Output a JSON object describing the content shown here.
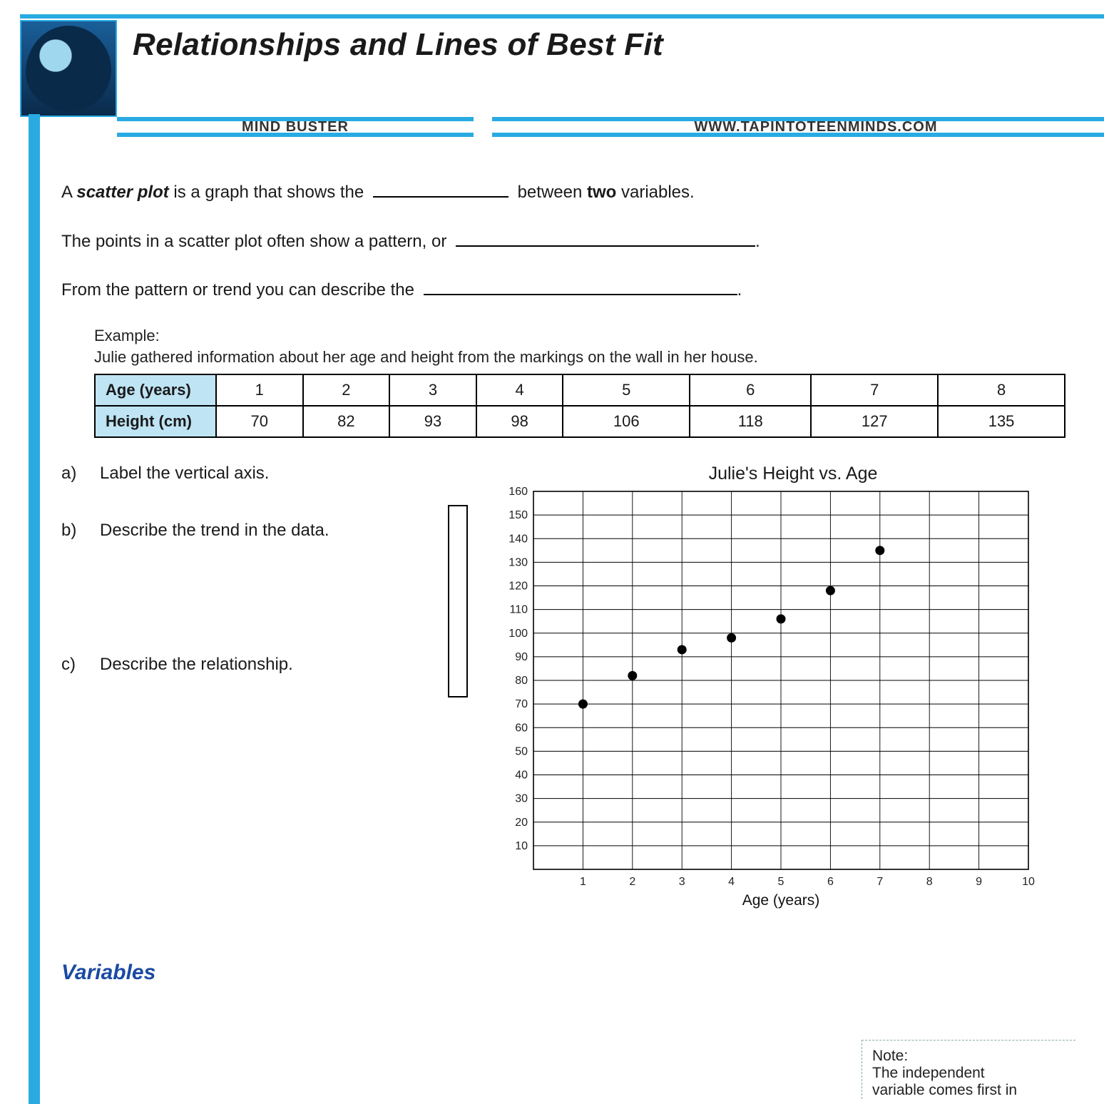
{
  "header": {
    "title": "Relationships and Lines of Best Fit",
    "subtitle_left": "MIND BUSTER",
    "subtitle_right": "WWW.TAPINTOTEENMINDS.COM"
  },
  "intro": {
    "line1_a": "A ",
    "line1_b": "scatter plot",
    "line1_c": " is a graph that shows the ",
    "line1_d": " between ",
    "line1_e": "two",
    "line1_f": " variables.",
    "line2": "The points in a scatter plot often show a pattern, or ",
    "line2_end": ".",
    "line3": "From the pattern or trend you can describe the ",
    "line3_end": "."
  },
  "example": {
    "label": "Example:",
    "text": "Julie gathered information about her age and height from the markings on the wall in her house.",
    "row1_label": "Age (years)",
    "row2_label": "Height (cm)",
    "ages": [
      "1",
      "2",
      "3",
      "4",
      "5",
      "6",
      "7",
      "8"
    ],
    "heights": [
      "70",
      "82",
      "93",
      "98",
      "106",
      "118",
      "127",
      "135"
    ]
  },
  "questions": {
    "a_lbl": "a)",
    "a_txt": "Label the vertical axis.",
    "b_lbl": "b)",
    "b_txt": "Describe the trend in the data.",
    "c_lbl": "c)",
    "c_txt": "Describe the relationship."
  },
  "chart_data": {
    "type": "scatter",
    "title": "Julie's Height vs. Age",
    "xlabel": "Age (years)",
    "ylabel": "",
    "xlim": [
      0,
      10
    ],
    "ylim": [
      0,
      160
    ],
    "xticks": [
      1,
      2,
      3,
      4,
      5,
      6,
      7,
      8,
      9,
      10
    ],
    "yticks": [
      10,
      20,
      30,
      40,
      50,
      60,
      70,
      80,
      90,
      100,
      110,
      120,
      130,
      140,
      150,
      160
    ],
    "series": [
      {
        "name": "Julie",
        "x": [
          1,
          2,
          3,
          4,
          5,
          6,
          7
        ],
        "y": [
          70,
          82,
          93,
          98,
          106,
          118,
          135
        ]
      }
    ]
  },
  "variables": {
    "heading": "Variables"
  },
  "note": {
    "l1": "Note:",
    "l2": "The independent",
    "l3": "variable comes first in"
  }
}
